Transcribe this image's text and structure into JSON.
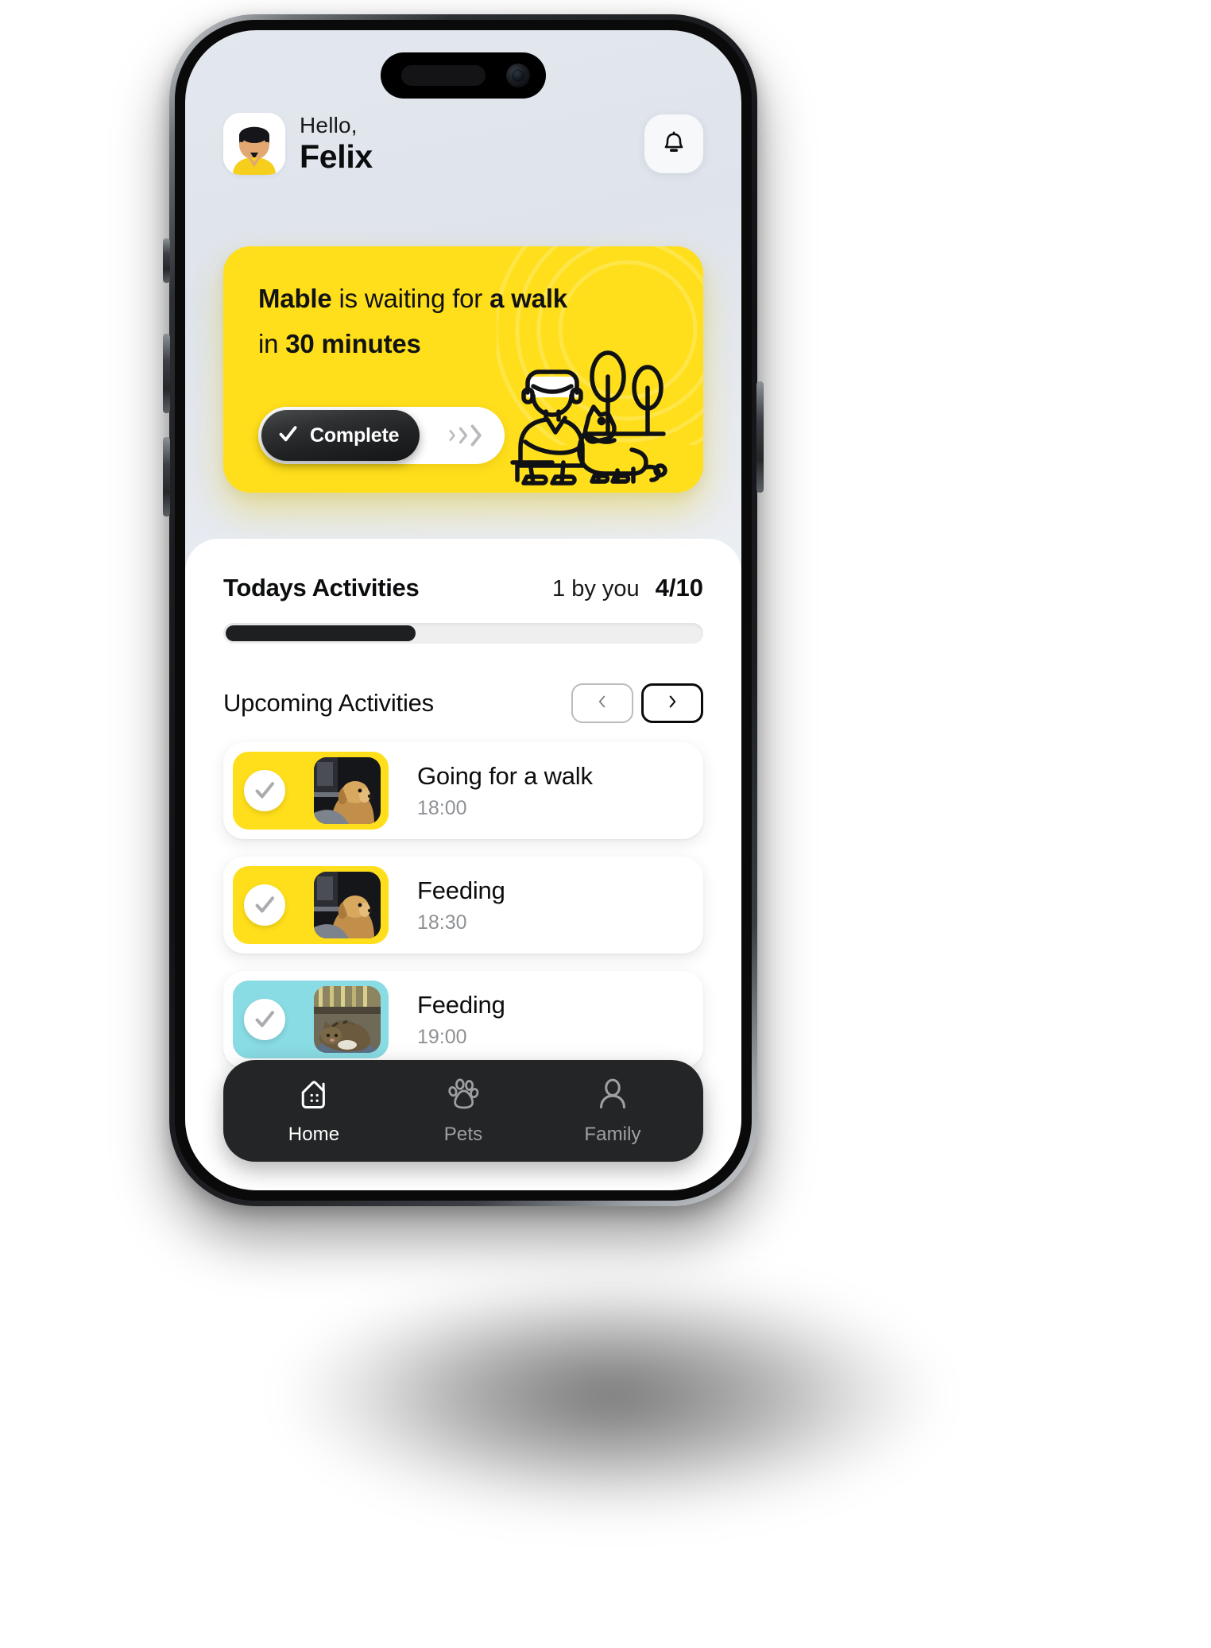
{
  "header": {
    "greeting": "Hello,",
    "user_name": "Felix",
    "avatar_name": "user-avatar",
    "bell_icon": "bell-icon"
  },
  "hero": {
    "pet_name": "Mable",
    "text_mid": " is waiting for ",
    "activity": "a walk",
    "text_in": "in ",
    "duration": "30 minutes",
    "slider_label": "Complete",
    "slider_icon": "check-icon",
    "chevrons_icon": "chevrons-right-icon",
    "illustration": "person-walking-dog-illustration",
    "card_color": "#ffdf1b"
  },
  "todays": {
    "title": "Todays Activities",
    "by_you": "1 by you",
    "count": "4/10",
    "progress_percent": 40
  },
  "upcoming": {
    "title": "Upcoming Activities",
    "prev_icon": "chevron-left-icon",
    "next_icon": "chevron-right-icon",
    "items": [
      {
        "name": "Going for a walk",
        "time": "18:00",
        "tile_color": "#ffdf1b",
        "pet_photo": "golden-retriever-photo",
        "check_icon": "check-circle-icon"
      },
      {
        "name": "Feeding",
        "time": "18:30",
        "tile_color": "#ffdf1b",
        "pet_photo": "golden-retriever-photo",
        "check_icon": "check-circle-icon"
      },
      {
        "name": "Feeding",
        "time": "19:00",
        "tile_color": "#89dbe4",
        "pet_photo": "tabby-cat-photo",
        "check_icon": "check-circle-icon"
      }
    ]
  },
  "bottom_nav": {
    "items": [
      {
        "label": "Home",
        "icon": "home-icon",
        "active": true
      },
      {
        "label": "Pets",
        "icon": "paw-icon",
        "active": false
      },
      {
        "label": "Family",
        "icon": "person-icon",
        "active": false
      }
    ]
  }
}
